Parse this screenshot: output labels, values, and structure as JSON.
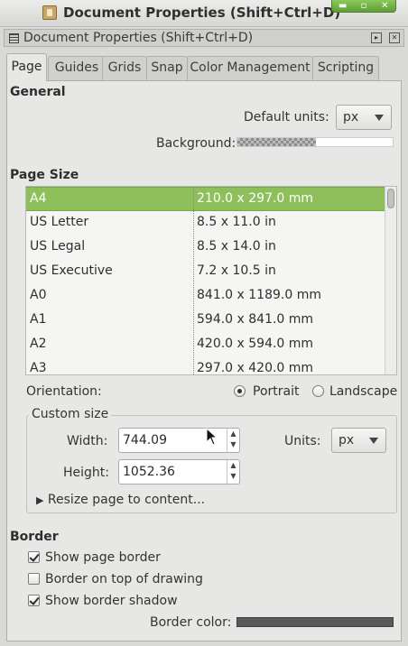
{
  "window": {
    "title": "Document Properties (Shift+Ctrl+D)",
    "controls": [
      "▬",
      "▫",
      "✕"
    ]
  },
  "dock": {
    "title": "Document Properties (Shift+Ctrl+D)",
    "buttons": [
      "▸",
      "✕"
    ]
  },
  "tabs": [
    "Page",
    "Guides",
    "Grids",
    "Snap",
    "Color Management",
    "Scripting"
  ],
  "general": {
    "heading": "General",
    "default_units_label": "Default units:",
    "default_units_value": "px",
    "background_label": "Background:"
  },
  "page_size": {
    "heading": "Page Size",
    "rows": [
      {
        "name": "A4",
        "size": "210.0 x 297.0 mm"
      },
      {
        "name": "US Letter",
        "size": "8.5 x 11.0 in"
      },
      {
        "name": "US Legal",
        "size": "8.5 x 14.0 in"
      },
      {
        "name": "US Executive",
        "size": "7.2 x 10.5 in"
      },
      {
        "name": "A0",
        "size": "841.0 x 1189.0 mm"
      },
      {
        "name": "A1",
        "size": "594.0 x 841.0 mm"
      },
      {
        "name": "A2",
        "size": "420.0 x 594.0 mm"
      },
      {
        "name": "A3",
        "size": "297.0 x 420.0 mm"
      }
    ],
    "selected": "A4"
  },
  "orientation": {
    "label": "Orientation:",
    "portrait": "Portrait",
    "landscape": "Landscape",
    "selected": "Portrait"
  },
  "custom_size": {
    "title": "Custom size",
    "width_label": "Width:",
    "width_value": "744.09",
    "height_label": "Height:",
    "height_value": "1052.36",
    "units_label": "Units:",
    "units_value": "px",
    "resize_label": "Resize page to content..."
  },
  "border": {
    "heading": "Border",
    "show_page_border": "Show page border",
    "show_page_border_checked": true,
    "border_on_top": "Border on top of drawing",
    "border_on_top_checked": false,
    "show_border_shadow": "Show border shadow",
    "show_border_shadow_checked": true,
    "border_color_label": "Border color:"
  },
  "colors": {
    "selection": "#8ebf5a",
    "window_bg": "#e7e7e5",
    "wm_buttons": "#6fae43",
    "border_color_swatch": "#5a5a5a"
  }
}
